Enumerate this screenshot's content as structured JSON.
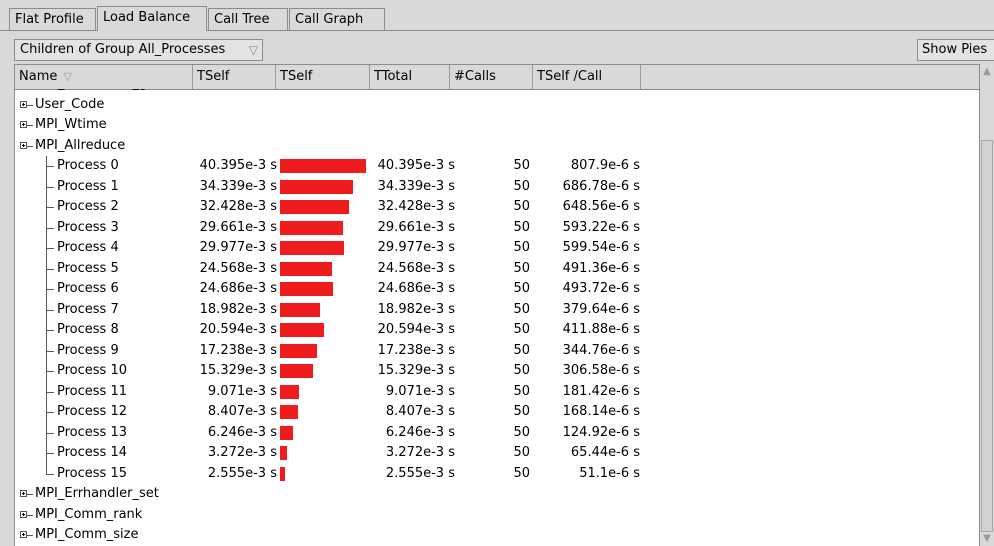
{
  "tabs": [
    "Flat Profile",
    "Load Balance",
    "Call Tree",
    "Call Graph"
  ],
  "active_tab": "Load Balance",
  "toolbar": {
    "group_select": "Children of Group All_Processes",
    "show_pies_label": "Show Pies"
  },
  "table": {
    "columns": [
      "Name",
      "TSelf",
      "TSelf",
      "TTotal",
      "#Calls",
      "TSelf /Call"
    ],
    "groups_before": [
      {
        "label": "MPI_Errhandler_get"
      },
      {
        "label": "User_Code"
      },
      {
        "label": "MPI_Wtime"
      },
      {
        "label": "MPI_Allreduce"
      }
    ],
    "children": [
      {
        "label": "Process 0",
        "tself": "40.395e-3 s",
        "bar_value": 40.395,
        "ttotal": "40.395e-3 s",
        "calls": "50",
        "per_call": "807.9e-6 s"
      },
      {
        "label": "Process 1",
        "tself": "34.339e-3 s",
        "bar_value": 34.339,
        "ttotal": "34.339e-3 s",
        "calls": "50",
        "per_call": "686.78e-6 s"
      },
      {
        "label": "Process 2",
        "tself": "32.428e-3 s",
        "bar_value": 32.428,
        "ttotal": "32.428e-3 s",
        "calls": "50",
        "per_call": "648.56e-6 s"
      },
      {
        "label": "Process 3",
        "tself": "29.661e-3 s",
        "bar_value": 29.661,
        "ttotal": "29.661e-3 s",
        "calls": "50",
        "per_call": "593.22e-6 s"
      },
      {
        "label": "Process 4",
        "tself": "29.977e-3 s",
        "bar_value": 29.977,
        "ttotal": "29.977e-3 s",
        "calls": "50",
        "per_call": "599.54e-6 s"
      },
      {
        "label": "Process 5",
        "tself": "24.568e-3 s",
        "bar_value": 24.568,
        "ttotal": "24.568e-3 s",
        "calls": "50",
        "per_call": "491.36e-6 s"
      },
      {
        "label": "Process 6",
        "tself": "24.686e-3 s",
        "bar_value": 24.686,
        "ttotal": "24.686e-3 s",
        "calls": "50",
        "per_call": "493.72e-6 s"
      },
      {
        "label": "Process 7",
        "tself": "18.982e-3 s",
        "bar_value": 18.982,
        "ttotal": "18.982e-3 s",
        "calls": "50",
        "per_call": "379.64e-6 s"
      },
      {
        "label": "Process 8",
        "tself": "20.594e-3 s",
        "bar_value": 20.594,
        "ttotal": "20.594e-3 s",
        "calls": "50",
        "per_call": "411.88e-6 s"
      },
      {
        "label": "Process 9",
        "tself": "17.238e-3 s",
        "bar_value": 17.238,
        "ttotal": "17.238e-3 s",
        "calls": "50",
        "per_call": "344.76e-6 s"
      },
      {
        "label": "Process 10",
        "tself": "15.329e-3 s",
        "bar_value": 15.329,
        "ttotal": "15.329e-3 s",
        "calls": "50",
        "per_call": "306.58e-6 s"
      },
      {
        "label": "Process 11",
        "tself": "9.071e-3 s",
        "bar_value": 9.071,
        "ttotal": "9.071e-3 s",
        "calls": "50",
        "per_call": "181.42e-6 s"
      },
      {
        "label": "Process 12",
        "tself": "8.407e-3 s",
        "bar_value": 8.407,
        "ttotal": "8.407e-3 s",
        "calls": "50",
        "per_call": "168.14e-6 s"
      },
      {
        "label": "Process 13",
        "tself": "6.246e-3 s",
        "bar_value": 6.246,
        "ttotal": "6.246e-3 s",
        "calls": "50",
        "per_call": "124.92e-6 s"
      },
      {
        "label": "Process 14",
        "tself": "3.272e-3 s",
        "bar_value": 3.272,
        "ttotal": "3.272e-3 s",
        "calls": "50",
        "per_call": "65.44e-6 s"
      },
      {
        "label": "Process 15",
        "tself": "2.555e-3 s",
        "bar_value": 2.555,
        "ttotal": "2.555e-3 s",
        "calls": "50",
        "per_call": "51.1e-6 s"
      }
    ],
    "groups_after": [
      {
        "label": "MPI_Errhandler_set"
      },
      {
        "label": "MPI_Comm_rank"
      },
      {
        "label": "MPI_Comm_size"
      }
    ]
  },
  "colors": {
    "bar": "#ee1c1c",
    "panel": "#d9d9d9",
    "table_bg": "#ffffff"
  },
  "icons": {
    "sort": "sort-triangle-icon",
    "dropdown": "dropdown-triangle-icon",
    "expander": "tree-expander-icon"
  }
}
